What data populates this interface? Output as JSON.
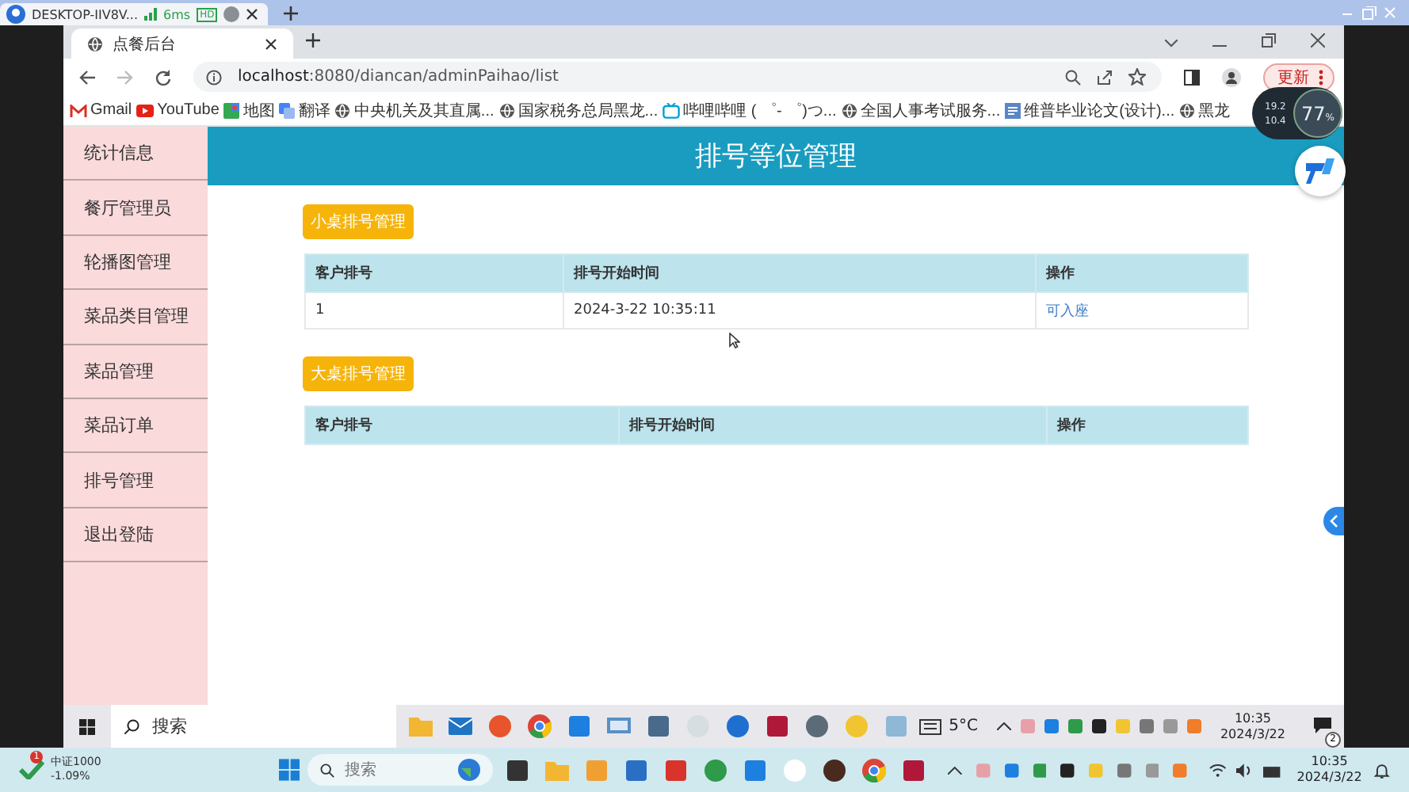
{
  "remote_tab": {
    "title": "DESKTOP-IIV8V...",
    "latency": "6ms",
    "quality": "HD"
  },
  "browser": {
    "tab_title": "点餐后台",
    "url_host": "localhost",
    "url_rest": ":8080/diancan/adminPaihao/list",
    "update_button": "更新",
    "bookmarks": [
      {
        "label": "Gmail",
        "kind": "gmail"
      },
      {
        "label": "YouTube",
        "kind": "youtube"
      },
      {
        "label": "地图",
        "kind": "maps"
      },
      {
        "label": "翻译",
        "kind": "translate"
      },
      {
        "label": "中央机关及其直属...",
        "kind": "globe"
      },
      {
        "label": "国家税务总局黑龙...",
        "kind": "globe"
      },
      {
        "label": "哔哩哔哩 ( ゜- ゜)つ...",
        "kind": "tv"
      },
      {
        "label": "全国人事考试服务...",
        "kind": "globe"
      },
      {
        "label": "维普毕业论文(设计)...",
        "kind": "doc"
      },
      {
        "label": "黑龙",
        "kind": "globe"
      }
    ]
  },
  "net_widget": {
    "upload": "19.2",
    "download": "10.4",
    "percent": "77",
    "percent_sign": "%"
  },
  "sidebar": {
    "items": [
      {
        "label": "统计信息"
      },
      {
        "label": "餐厅管理员"
      },
      {
        "label": "轮播图管理"
      },
      {
        "label": "菜品类目管理"
      },
      {
        "label": "菜品管理"
      },
      {
        "label": "菜品订单"
      },
      {
        "label": "排号管理"
      },
      {
        "label": "退出登陆"
      }
    ]
  },
  "page_title": "排号等位管理",
  "sections": [
    {
      "button": "小桌排号管理",
      "columns": [
        "客户排号",
        "排号开始时间",
        "操作"
      ],
      "rows": [
        {
          "number": "1",
          "time": "2024-3-22 10:35:11",
          "action": "可入座"
        }
      ]
    },
    {
      "button": "大桌排号管理",
      "columns": [
        "客户排号",
        "排号开始时间",
        "操作"
      ]
    }
  ],
  "inner_taskbar": {
    "search_placeholder": "搜索",
    "weather": "5°C",
    "time": "10:35",
    "date": "2024/3/22",
    "notification_count": "2"
  },
  "outer_taskbar": {
    "stock_badge": "1",
    "stock_name": "中证1000",
    "stock_change": "-1.09%",
    "search_placeholder": "搜索",
    "time": "10:35",
    "date": "2024/3/22"
  }
}
